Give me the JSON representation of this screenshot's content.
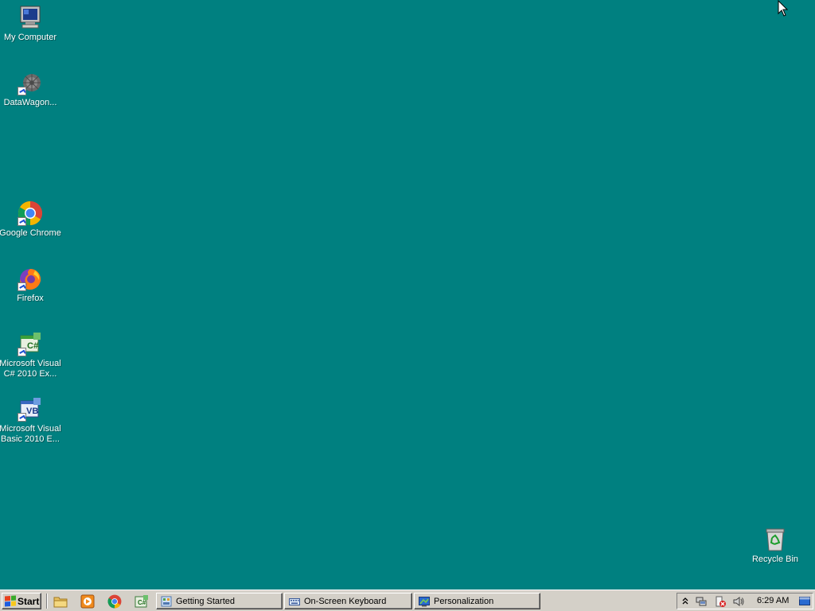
{
  "desktop": {
    "icons": [
      {
        "label": "My Computer",
        "icon": "my-computer-icon"
      },
      {
        "label": "DataWagon...",
        "icon": "datawagon-icon"
      },
      {
        "label": "Google Chrome",
        "icon": "chrome-icon"
      },
      {
        "label": "Firefox",
        "icon": "firefox-icon"
      },
      {
        "label": "Microsoft Visual C# 2010 Ex...",
        "line1": "Microsoft Visual",
        "line2": "C# 2010 Ex...",
        "icon": "visual-csharp-icon"
      },
      {
        "label": "Microsoft Visual Basic 2010 E...",
        "line1": "Microsoft Visual",
        "line2": "Basic 2010 E...",
        "icon": "visual-basic-icon"
      },
      {
        "label": "Recycle Bin",
        "icon": "recycle-bin-icon"
      }
    ],
    "background_color": "#008080"
  },
  "taskbar": {
    "start_label": "Start",
    "quick_launch": [
      "file-explorer-icon",
      "media-player-icon",
      "chrome-icon",
      "visual-csharp-icon"
    ],
    "tasks": [
      {
        "label": "Getting Started",
        "icon": "getting-started-icon"
      },
      {
        "label": "On-Screen Keyboard",
        "icon": "keyboard-icon"
      },
      {
        "label": "Personalization",
        "icon": "personalization-icon"
      }
    ],
    "tray": {
      "icons": [
        "show-hidden-icons-chevron",
        "network-icon",
        "action-center-icon",
        "volume-icon"
      ],
      "time": "6:29 AM"
    }
  }
}
